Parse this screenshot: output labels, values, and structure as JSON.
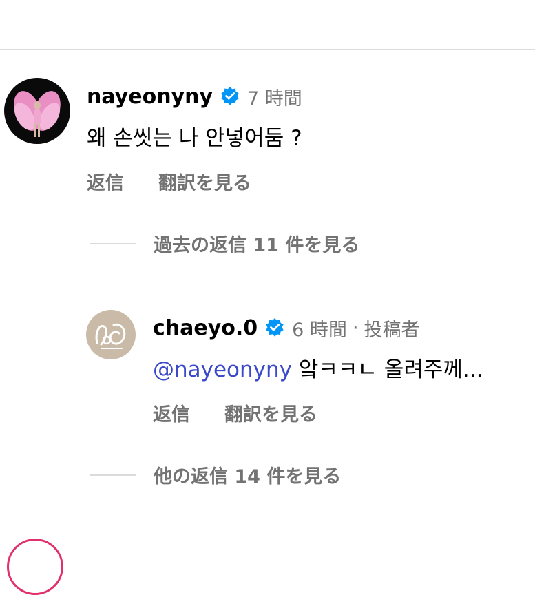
{
  "comments": [
    {
      "username": "nayeonyny",
      "verified": true,
      "time": "7 時間",
      "text": "왜 손씻는 나 안넣어둠 ?",
      "reply_label": "返信",
      "translate_label": "翻訳を見る",
      "view_replies": "過去の返信 11 件を見る",
      "avatar_icon": "angel-wings-photo-icon"
    },
    {
      "username": "chaeyo.0",
      "verified": true,
      "time": "6 時間",
      "separator": "·",
      "author_tag": "投稿者",
      "mention": "@nayeonyny",
      "text": " 앜ㅋㅋㄴ 올려주께...",
      "reply_label": "返信",
      "translate_label": "翻訳を見る",
      "view_replies": "他の返信 14 件を見る",
      "avatar_icon": "handwritten-logo-icon"
    }
  ],
  "colors": {
    "verified_badge": "#0095f6",
    "mention": "#3a49c9",
    "secondary_text": "#737373",
    "divider": "#dbdbdb"
  }
}
